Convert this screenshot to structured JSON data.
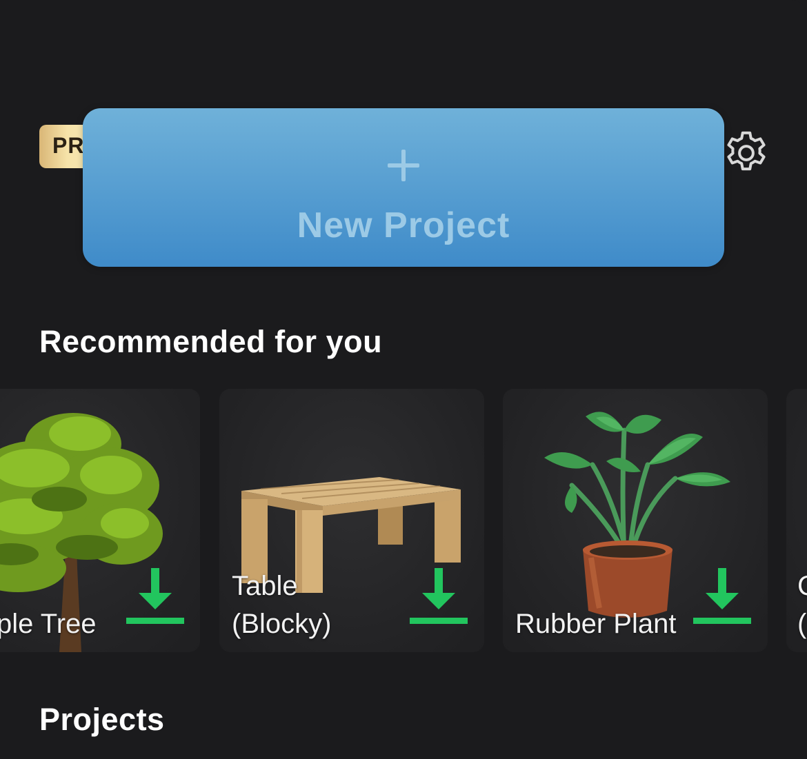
{
  "header": {
    "pro_badge": "PRO",
    "settings_icon": "gear-icon"
  },
  "new_project": {
    "icon": "plus-icon",
    "label": "New Project"
  },
  "recommended": {
    "title": "Recommended for you",
    "items": [
      {
        "name": "ple Tree",
        "icon": "tree-model"
      },
      {
        "name": "Table\n(Blocky)",
        "name_line1": "Table",
        "name_line2": "(Blocky)",
        "icon": "table-model"
      },
      {
        "name": "Rubber Plant",
        "icon": "plant-model"
      },
      {
        "name_line1": "C",
        "name_line2": "("
      }
    ],
    "download_icon": "download-icon"
  },
  "projects": {
    "title": "Projects"
  },
  "colors": {
    "background": "#1b1b1d",
    "new_project_top": "#6fb1d9",
    "new_project_bottom": "#3f8bc9",
    "download_green": "#22c55e",
    "pro_gold": "#f6e3a9"
  }
}
